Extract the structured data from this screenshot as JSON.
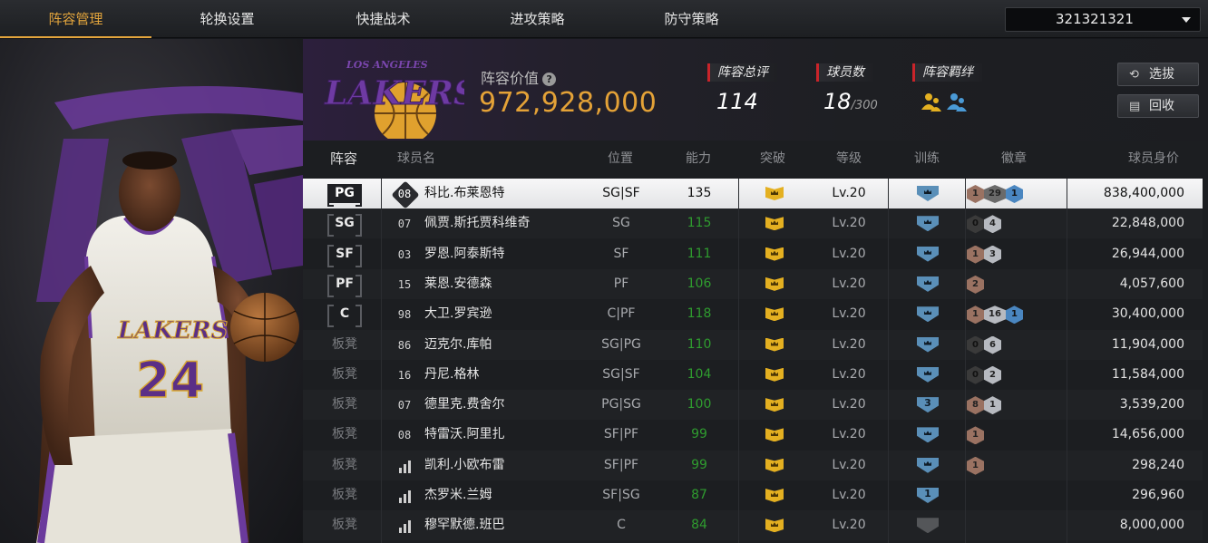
{
  "tabs": [
    "阵容管理",
    "轮换设置",
    "快捷战术",
    "进攻策略",
    "防守策略"
  ],
  "team_select": {
    "value": "321321321"
  },
  "header": {
    "value_label": "阵容价值",
    "value": "972,928,000",
    "overall_label": "阵容总评",
    "overall": "114",
    "players_label": "球员数",
    "players_count": "18",
    "players_max": "/300",
    "synergy_label": "阵容羁绊",
    "buttons": {
      "select": "选拔",
      "recycle": "回收"
    }
  },
  "logo_text": {
    "small": "LOS ANGELES",
    "big": "LAKERS"
  },
  "hero_jersey": {
    "team": "LAKERS",
    "number": "24"
  },
  "columns": {
    "lineup": "阵容",
    "name": "球员名",
    "position": "位置",
    "ability": "能力",
    "breakthrough": "突破",
    "level": "等级",
    "training": "训练",
    "badges": "徽章",
    "value": "球员身价"
  },
  "rows": [
    {
      "slot": "PG",
      "num": "08",
      "numtype": "hex",
      "name": "科比.布莱恩特",
      "pos": "SG|SF",
      "ability": "135",
      "level": "Lv.20",
      "train": "crown",
      "badges": [
        [
          "bronze",
          "1"
        ],
        [
          "gold",
          "29"
        ],
        [
          "blue",
          "1"
        ]
      ],
      "value": "838,400,000"
    },
    {
      "slot": "SG",
      "num": "07",
      "numtype": "plain",
      "name": "佩贾.斯托贾科维奇",
      "pos": "SG",
      "ability": "115",
      "level": "Lv.20",
      "train": "crown",
      "badges": [
        [
          "dark",
          "0"
        ],
        [
          "silver",
          "4"
        ]
      ],
      "value": "22,848,000"
    },
    {
      "slot": "SF",
      "num": "03",
      "numtype": "plain",
      "name": "罗恩.阿泰斯特",
      "pos": "SF",
      "ability": "111",
      "level": "Lv.20",
      "train": "crown",
      "badges": [
        [
          "bronze",
          "1"
        ],
        [
          "silver",
          "3"
        ]
      ],
      "value": "26,944,000"
    },
    {
      "slot": "PF",
      "num": "15",
      "numtype": "plain",
      "name": "莱恩.安德森",
      "pos": "PF",
      "ability": "106",
      "level": "Lv.20",
      "train": "crown",
      "badges": [
        [
          "bronze",
          "2"
        ]
      ],
      "value": "4,057,600"
    },
    {
      "slot": "C",
      "num": "98",
      "numtype": "plain",
      "name": "大卫.罗宾逊",
      "pos": "C|PF",
      "ability": "118",
      "level": "Lv.20",
      "train": "crown",
      "badges": [
        [
          "bronze",
          "1"
        ],
        [
          "silver",
          "16"
        ],
        [
          "blue",
          "1"
        ]
      ],
      "value": "30,400,000"
    },
    {
      "slot": "板凳",
      "num": "86",
      "numtype": "plain",
      "name": "迈克尔.库帕",
      "pos": "SG|PG",
      "ability": "110",
      "level": "Lv.20",
      "train": "crown",
      "badges": [
        [
          "dark",
          "0"
        ],
        [
          "silver",
          "6"
        ]
      ],
      "value": "11,904,000"
    },
    {
      "slot": "板凳",
      "num": "16",
      "numtype": "plain",
      "name": "丹尼.格林",
      "pos": "SG|SF",
      "ability": "104",
      "level": "Lv.20",
      "train": "crown",
      "badges": [
        [
          "dark",
          "0"
        ],
        [
          "silver",
          "2"
        ]
      ],
      "value": "11,584,000"
    },
    {
      "slot": "板凳",
      "num": "07",
      "numtype": "plain",
      "name": "德里克.费舍尔",
      "pos": "PG|SG",
      "ability": "100",
      "level": "Lv.20",
      "train": "3",
      "badges": [
        [
          "bronze",
          "8"
        ],
        [
          "silver",
          "1"
        ]
      ],
      "value": "3,539,200"
    },
    {
      "slot": "板凳",
      "num": "08",
      "numtype": "plain",
      "name": "特雷沃.阿里扎",
      "pos": "SF|PF",
      "ability": "99",
      "level": "Lv.20",
      "train": "crown",
      "badges": [
        [
          "bronze",
          "1"
        ]
      ],
      "value": "14,656,000"
    },
    {
      "slot": "板凳",
      "num": "",
      "numtype": "bars",
      "name": "凯利.小欧布雷",
      "pos": "SF|PF",
      "ability": "99",
      "level": "Lv.20",
      "train": "crown",
      "badges": [
        [
          "bronze",
          "1"
        ]
      ],
      "value": "298,240"
    },
    {
      "slot": "板凳",
      "num": "",
      "numtype": "bars",
      "name": "杰罗米.兰姆",
      "pos": "SF|SG",
      "ability": "87",
      "level": "Lv.20",
      "train": "1",
      "badges": [],
      "value": "296,960"
    },
    {
      "slot": "板凳",
      "num": "",
      "numtype": "bars",
      "name": "穆罕默德.班巴",
      "pos": "C",
      "ability": "84",
      "level": "Lv.20",
      "train": "grey",
      "badges": [],
      "value": "8,000,000"
    }
  ],
  "colors": {
    "accent": "#e2a43c",
    "ability_green": "#2f9c2f",
    "crown": "#e4b021",
    "train_blue": "#5a8fb8",
    "red_marker": "#c9242a"
  }
}
